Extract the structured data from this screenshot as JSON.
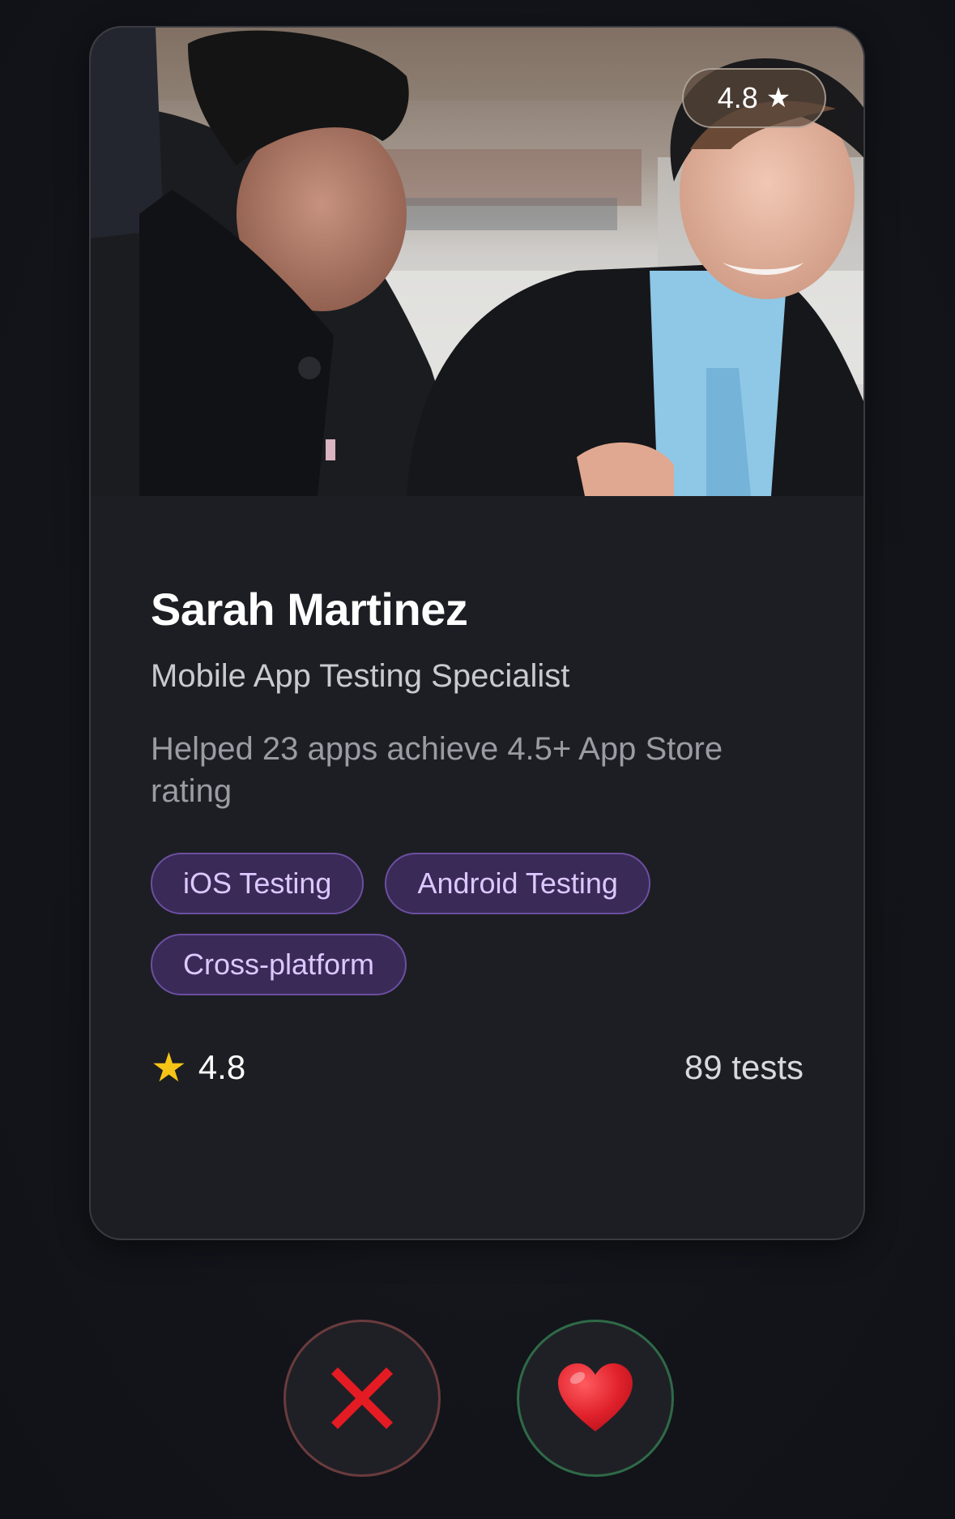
{
  "profile": {
    "name": "Sarah Martinez",
    "role": "Mobile App Testing Specialist",
    "summary": "Helped 23 apps achieve 4.5+ App Store rating",
    "photo_badge_rating": "4.8",
    "photo_badge_icon": "star-icon",
    "tags": [
      "iOS Testing",
      "Android Testing",
      "Cross-platform"
    ],
    "rating": "4.8",
    "rating_icon": "gold-star-icon",
    "tests": "89 tests"
  },
  "actions": {
    "reject_icon": "red-x-icon",
    "like_icon": "red-heart-icon"
  },
  "colors": {
    "background": "#13151b",
    "card": "#1d1e23",
    "tag_bg": "#3a2a58",
    "tag_border": "#6b4fa0",
    "tag_text": "#dcc8ff",
    "star": "#f6c416",
    "reject_ring": "#6a3b3d",
    "like_ring": "#2f6a47",
    "reject": "#e41b23",
    "heart": "#e0212b"
  }
}
